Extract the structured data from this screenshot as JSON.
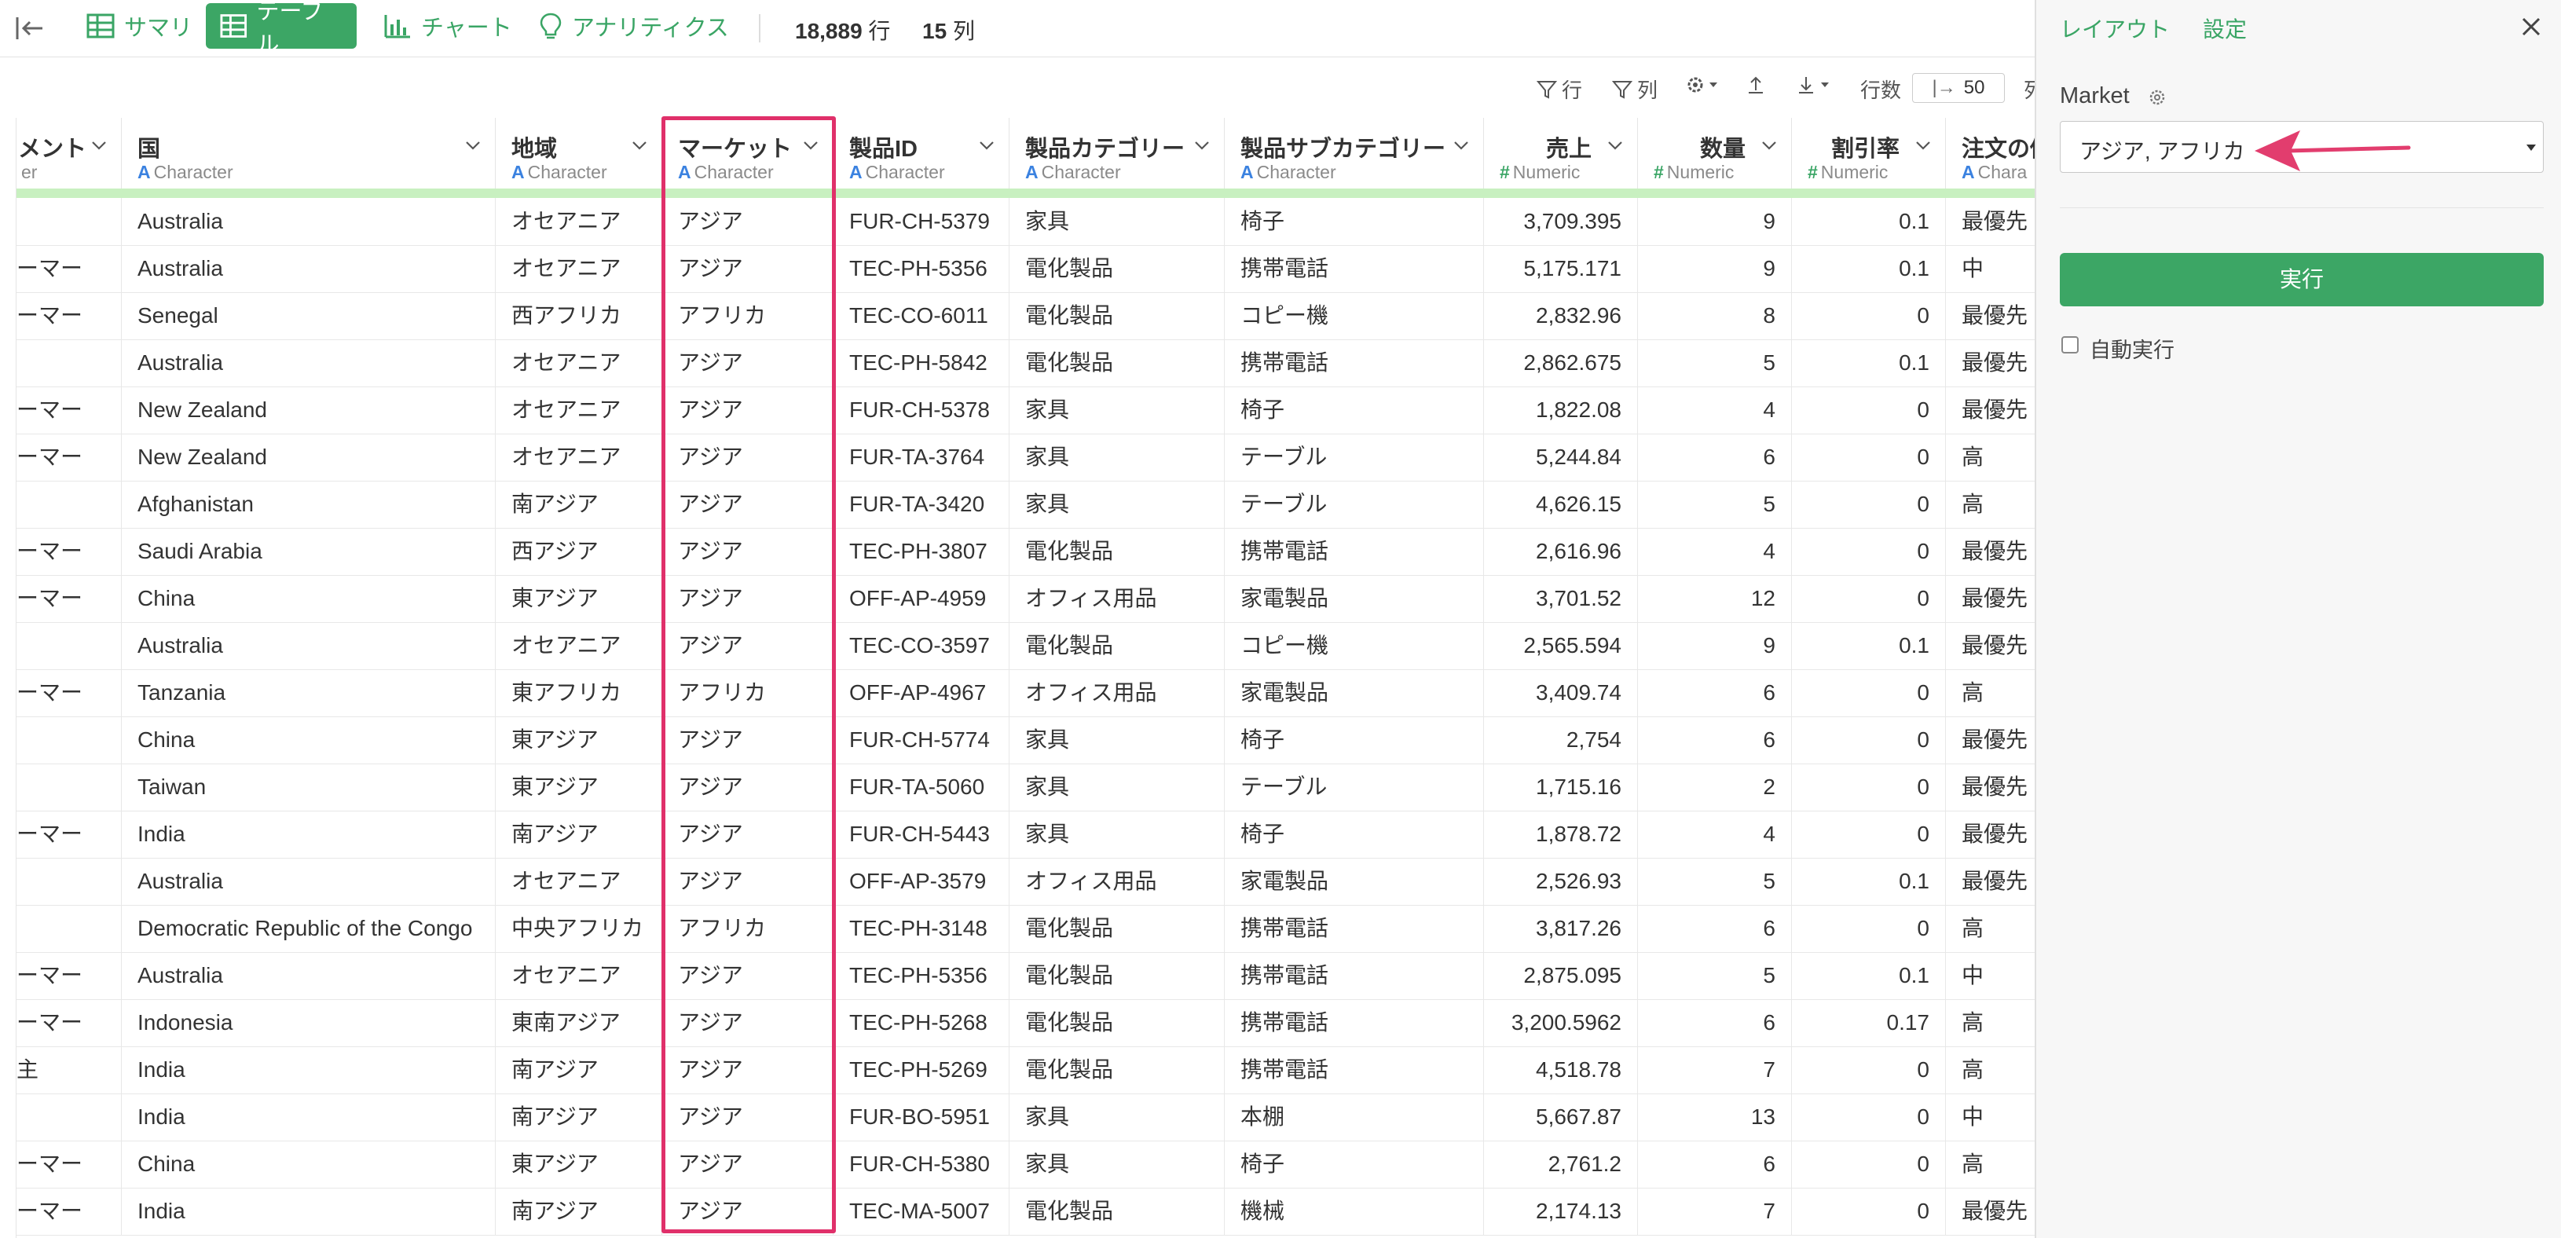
{
  "topbar": {
    "tabs": [
      {
        "label": "サマリ",
        "icon": "table-grid-icon",
        "active": false
      },
      {
        "label": "テーブル",
        "icon": "table-grid-icon",
        "active": true
      },
      {
        "label": "チャート",
        "icon": "bar-chart-icon",
        "active": false
      },
      {
        "label": "アナリティクス",
        "icon": "lightbulb-icon",
        "active": false
      }
    ],
    "row_count": "18,889",
    "row_unit": "行",
    "col_count": "15",
    "col_unit": "列"
  },
  "toolbar": {
    "row_filter": "行",
    "col_filter": "列",
    "row_count_label": "行数",
    "row_count_value": "50",
    "col_cut": "列"
  },
  "table": {
    "columns": [
      {
        "name": "メント",
        "type": "er",
        "kind": "char"
      },
      {
        "name": "国",
        "type": "Character",
        "kind": "char"
      },
      {
        "name": "地域",
        "type": "Character",
        "kind": "char"
      },
      {
        "name": "マーケット",
        "type": "Character",
        "kind": "char"
      },
      {
        "name": "製品ID",
        "type": "Character",
        "kind": "char"
      },
      {
        "name": "製品カテゴリー",
        "type": "Character",
        "kind": "char"
      },
      {
        "name": "製品サブカテゴリー",
        "type": "Character",
        "kind": "char"
      },
      {
        "name": "売上",
        "type": "Numeric",
        "kind": "num"
      },
      {
        "name": "数量",
        "type": "Numeric",
        "kind": "num"
      },
      {
        "name": "割引率",
        "type": "Numeric",
        "kind": "num"
      },
      {
        "name": "注文の優",
        "type": "Chara",
        "kind": "char"
      }
    ],
    "rows": [
      [
        "",
        "Australia",
        "オセアニア",
        "アジア",
        "FUR-CH-5379",
        "家具",
        "椅子",
        "3,709.395",
        "9",
        "0.1",
        "最優先"
      ],
      [
        "ーマー",
        "Australia",
        "オセアニア",
        "アジア",
        "TEC-PH-5356",
        "電化製品",
        "携帯電話",
        "5,175.171",
        "9",
        "0.1",
        "中"
      ],
      [
        "ーマー",
        "Senegal",
        "西アフリカ",
        "アフリカ",
        "TEC-CO-6011",
        "電化製品",
        "コピー機",
        "2,832.96",
        "8",
        "0",
        "最優先"
      ],
      [
        "",
        "Australia",
        "オセアニア",
        "アジア",
        "TEC-PH-5842",
        "電化製品",
        "携帯電話",
        "2,862.675",
        "5",
        "0.1",
        "最優先"
      ],
      [
        "ーマー",
        "New Zealand",
        "オセアニア",
        "アジア",
        "FUR-CH-5378",
        "家具",
        "椅子",
        "1,822.08",
        "4",
        "0",
        "最優先"
      ],
      [
        "ーマー",
        "New Zealand",
        "オセアニア",
        "アジア",
        "FUR-TA-3764",
        "家具",
        "テーブル",
        "5,244.84",
        "6",
        "0",
        "高"
      ],
      [
        "",
        "Afghanistan",
        "南アジア",
        "アジア",
        "FUR-TA-3420",
        "家具",
        "テーブル",
        "4,626.15",
        "5",
        "0",
        "高"
      ],
      [
        "ーマー",
        "Saudi Arabia",
        "西アジア",
        "アジア",
        "TEC-PH-3807",
        "電化製品",
        "携帯電話",
        "2,616.96",
        "4",
        "0",
        "最優先"
      ],
      [
        "ーマー",
        "China",
        "東アジア",
        "アジア",
        "OFF-AP-4959",
        "オフィス用品",
        "家電製品",
        "3,701.52",
        "12",
        "0",
        "最優先"
      ],
      [
        "",
        "Australia",
        "オセアニア",
        "アジア",
        "TEC-CO-3597",
        "電化製品",
        "コピー機",
        "2,565.594",
        "9",
        "0.1",
        "最優先"
      ],
      [
        "ーマー",
        "Tanzania",
        "東アフリカ",
        "アフリカ",
        "OFF-AP-4967",
        "オフィス用品",
        "家電製品",
        "3,409.74",
        "6",
        "0",
        "高"
      ],
      [
        "",
        "China",
        "東アジア",
        "アジア",
        "FUR-CH-5774",
        "家具",
        "椅子",
        "2,754",
        "6",
        "0",
        "最優先"
      ],
      [
        "",
        "Taiwan",
        "東アジア",
        "アジア",
        "FUR-TA-5060",
        "家具",
        "テーブル",
        "1,715.16",
        "2",
        "0",
        "最優先"
      ],
      [
        "ーマー",
        "India",
        "南アジア",
        "アジア",
        "FUR-CH-5443",
        "家具",
        "椅子",
        "1,878.72",
        "4",
        "0",
        "最優先"
      ],
      [
        "",
        "Australia",
        "オセアニア",
        "アジア",
        "OFF-AP-3579",
        "オフィス用品",
        "家電製品",
        "2,526.93",
        "5",
        "0.1",
        "最優先"
      ],
      [
        "",
        "Democratic Republic of the Congo",
        "中央アフリカ",
        "アフリカ",
        "TEC-PH-3148",
        "電化製品",
        "携帯電話",
        "3,817.26",
        "6",
        "0",
        "高"
      ],
      [
        "ーマー",
        "Australia",
        "オセアニア",
        "アジア",
        "TEC-PH-5356",
        "電化製品",
        "携帯電話",
        "2,875.095",
        "5",
        "0.1",
        "中"
      ],
      [
        "ーマー",
        "Indonesia",
        "東南アジア",
        "アジア",
        "TEC-PH-5268",
        "電化製品",
        "携帯電話",
        "3,200.5962",
        "6",
        "0.17",
        "高"
      ],
      [
        "主",
        "India",
        "南アジア",
        "アジア",
        "TEC-PH-5269",
        "電化製品",
        "携帯電話",
        "4,518.78",
        "7",
        "0",
        "高"
      ],
      [
        "",
        "India",
        "南アジア",
        "アジア",
        "FUR-BO-5951",
        "家具",
        "本棚",
        "5,667.87",
        "13",
        "0",
        "中"
      ],
      [
        "ーマー",
        "China",
        "東アジア",
        "アジア",
        "FUR-CH-5380",
        "家具",
        "椅子",
        "2,761.2",
        "6",
        "0",
        "高"
      ],
      [
        "ーマー",
        "India",
        "南アジア",
        "アジア",
        "TEC-MA-5007",
        "電化製品",
        "機械",
        "2,174.13",
        "7",
        "0",
        "最優先"
      ]
    ]
  },
  "panel": {
    "tabs": [
      "レイアウト",
      "設定"
    ],
    "field_label": "Market",
    "field_value": "アジア, アフリカ",
    "run_label": "実行",
    "auto_run_label": "自動実行",
    "auto_run_checked": false
  },
  "colors": {
    "accent_green": "#3ca665",
    "highlight_pink": "#e0306a",
    "char_type_blue": "#3b82e0"
  }
}
